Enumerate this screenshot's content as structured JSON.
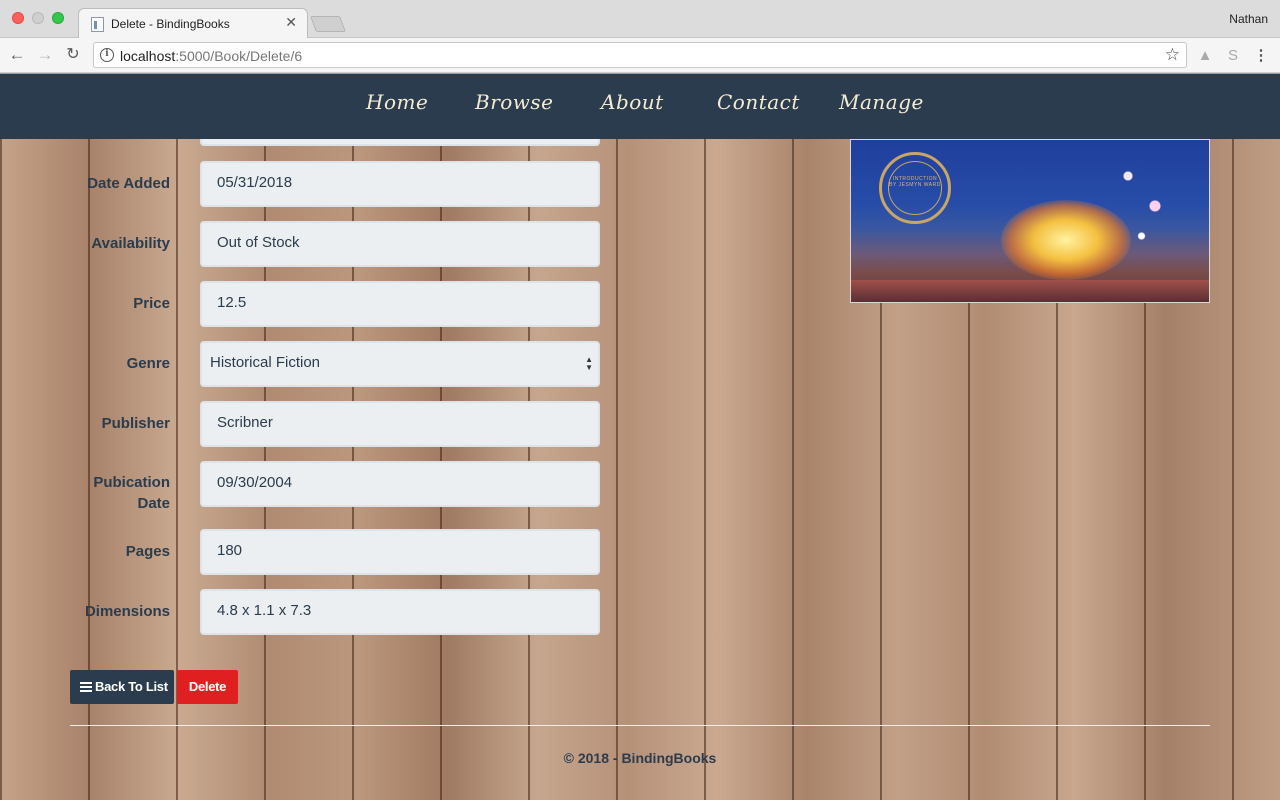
{
  "browser": {
    "tab_title": "Delete - BindingBooks",
    "tab_close": "✕",
    "profile_name": "Nathan",
    "url_host": "localhost",
    "url_path": ":5000/Book/Delete/6"
  },
  "nav": {
    "links": [
      "Home",
      "Browse",
      "About",
      "Contact",
      "Manage"
    ]
  },
  "form": {
    "fields": [
      {
        "label": "Date Added",
        "value": "05/31/2018"
      },
      {
        "label": "Availability",
        "value": "Out of Stock"
      },
      {
        "label": "Price",
        "value": "12.5"
      },
      {
        "label": "Genre",
        "value": "Historical Fiction"
      },
      {
        "label": "Publisher",
        "value": "Scribner"
      },
      {
        "label": "Pubication Date",
        "value": "09/30/2004"
      },
      {
        "label": "Pages",
        "value": "180"
      },
      {
        "label": "Dimensions",
        "value": "4.8 x 1.1 x 7.3"
      }
    ]
  },
  "cover": {
    "seal_text": "INTRODUCTION BY JESMYN WARD"
  },
  "actions": {
    "back_label": "Back To List",
    "delete_label": "Delete"
  },
  "footer": {
    "text": "© 2018 - BindingBooks"
  },
  "colors": {
    "navbar": "#2a3c4d",
    "delete_button": "#e02020",
    "input_bg": "#eceff1",
    "nav_link": "#f4ecd2"
  }
}
